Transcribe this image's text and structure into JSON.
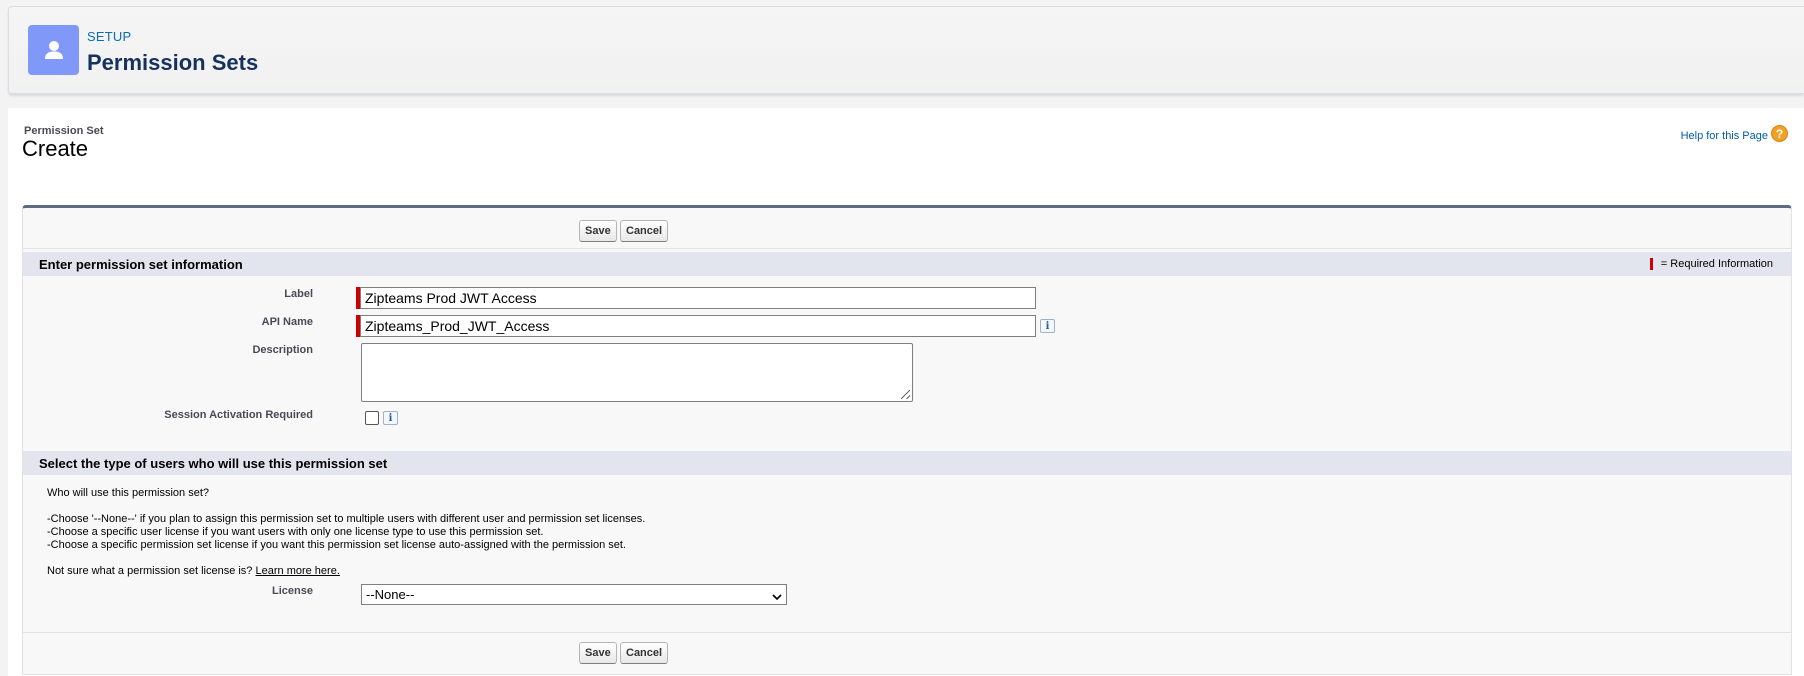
{
  "header": {
    "crumb": "SETUP",
    "title": "Permission Sets"
  },
  "page": {
    "type_label": "Permission Set",
    "title": "Create",
    "help_link": "Help for this Page",
    "help_icon_glyph": "?"
  },
  "buttons": {
    "save": "Save",
    "cancel": "Cancel"
  },
  "section_info": {
    "title": "Enter permission set information",
    "required_legend": "= Required Information",
    "fields": {
      "label": {
        "label": "Label",
        "value": "Zipteams Prod JWT Access"
      },
      "api_name": {
        "label": "API Name",
        "value": "Zipteams_Prod_JWT_Access"
      },
      "description": {
        "label": "Description",
        "value": ""
      },
      "session_activation": {
        "label": "Session Activation Required",
        "checked": false
      }
    },
    "info_glyph": "i"
  },
  "section_users": {
    "title": "Select the type of users who will use this permission set",
    "question": "Who will use this permission set?",
    "instructions": [
      "-Choose '--None--' if you plan to assign this permission set to multiple users with different user and permission set licenses.",
      "-Choose a specific user license if you want users with only one license type to use this permission set.",
      "-Choose a specific permission set license if you want this permission set license auto-assigned with the permission set."
    ],
    "not_sure": "Not sure what a permission set license is?",
    "learn_more": "Learn more here.",
    "license_label": "License",
    "license_value": "--None--"
  },
  "colors": {
    "icon_bg": "#8098f8",
    "required": "#cc0000",
    "section_bg": "#e2e5ee",
    "block_top_border": "#5e6a80"
  },
  "icons": {
    "setup": "user-icon",
    "help": "help-icon",
    "info": "info-icon",
    "select": "chevron-down-icon"
  }
}
